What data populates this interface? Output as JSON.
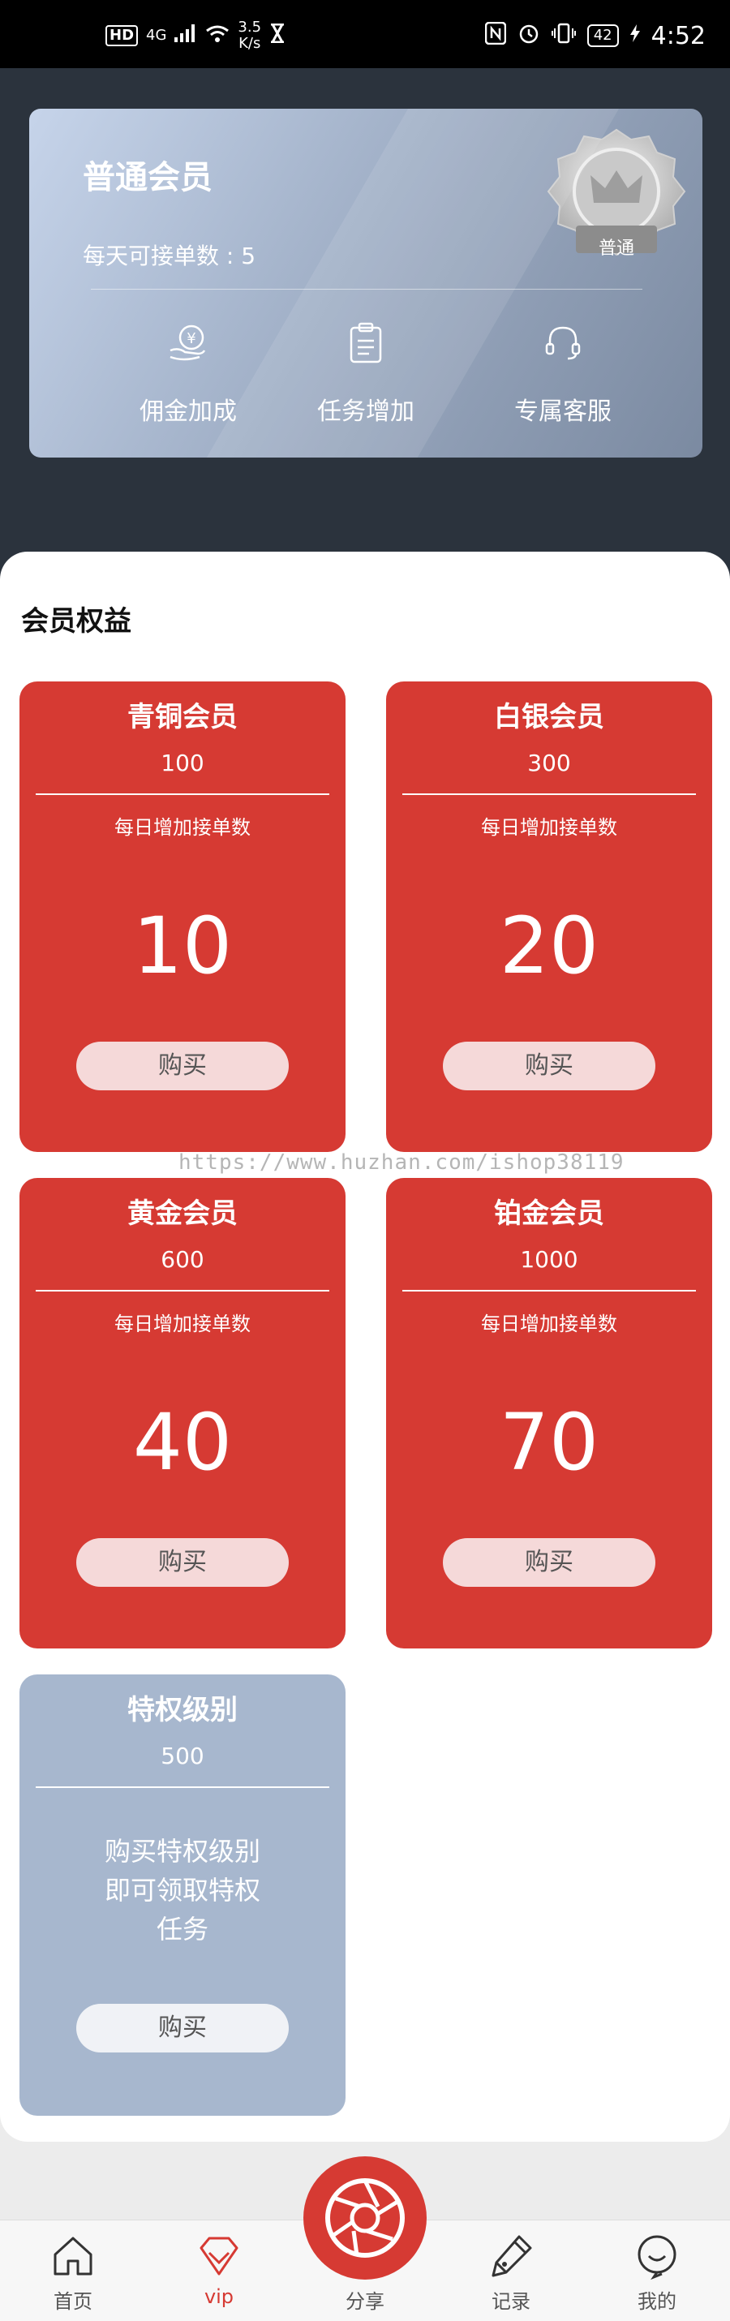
{
  "status_bar": {
    "hd": "HD",
    "network": "4G",
    "speed_value": "3.5",
    "speed_unit": "K/s",
    "battery": "42",
    "time": "4:52"
  },
  "member_card": {
    "level_title": "普通会员",
    "daily_orders": "每天可接单数 : 5",
    "badge_label": "普通",
    "features": [
      "佣金加成",
      "任务增加",
      "专属客服"
    ]
  },
  "benefits": {
    "title": "会员权益",
    "tiers": [
      {
        "name": "青铜会员",
        "price": "100",
        "desc": "每日增加接单数",
        "value": "10",
        "buy_label": "购买"
      },
      {
        "name": "白银会员",
        "price": "300",
        "desc": "每日增加接单数",
        "value": "20",
        "buy_label": "购买"
      },
      {
        "name": "黄金会员",
        "price": "600",
        "desc": "每日增加接单数",
        "value": "40",
        "buy_label": "购买"
      },
      {
        "name": "铂金会员",
        "price": "1000",
        "desc": "每日增加接单数",
        "value": "70",
        "buy_label": "购买"
      }
    ],
    "privilege": {
      "name": "特权级别",
      "price": "500",
      "desc_lines": [
        "购买特权级别",
        "即可领取特权",
        "任务"
      ],
      "buy_label": "购买"
    }
  },
  "watermark": "https://www.huzhan.com/ishop38119",
  "tab_bar": {
    "items": [
      "首页",
      "vip",
      "分享",
      "记录",
      "我的"
    ],
    "active_index": 1,
    "accent_color": "#d63a33"
  }
}
